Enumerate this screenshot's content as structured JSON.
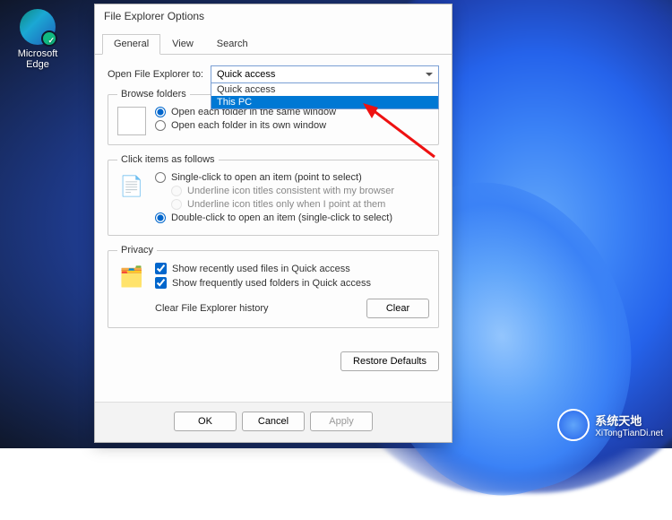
{
  "desktop": {
    "icon_label_1": "Microsoft",
    "icon_label_2": "Edge"
  },
  "dialog": {
    "title": "File Explorer Options",
    "tabs": [
      "General",
      "View",
      "Search"
    ],
    "open_label": "Open File Explorer to:",
    "dropdown": {
      "selected": "Quick access",
      "options": [
        "Quick access",
        "This PC"
      ]
    },
    "browse": {
      "legend": "Browse folders",
      "opt1": "Open each folder in the same window",
      "opt2": "Open each folder in its own window"
    },
    "click": {
      "legend": "Click items as follows",
      "opt1": "Single-click to open an item (point to select)",
      "sub1": "Underline icon titles consistent with my browser",
      "sub2": "Underline icon titles only when I point at them",
      "opt2": "Double-click to open an item (single-click to select)"
    },
    "privacy": {
      "legend": "Privacy",
      "chk1": "Show recently used files in Quick access",
      "chk2": "Show frequently used folders in Quick access",
      "clear_label": "Clear File Explorer history",
      "clear_btn": "Clear"
    },
    "restore": "Restore Defaults",
    "ok": "OK",
    "cancel": "Cancel",
    "apply": "Apply"
  },
  "watermark": {
    "text1": "系统天地",
    "text2": "XiTongTianDi.net"
  }
}
